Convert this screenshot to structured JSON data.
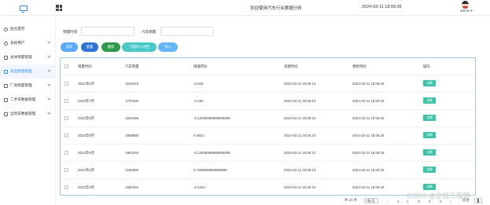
{
  "header": {
    "title": "欢迎使用汽车行业数据分析",
    "datetime": "2024-03-11 18:09:36",
    "username": "admin"
  },
  "sidebar": {
    "items": [
      {
        "label": "后台首页",
        "icon": "clock-icon",
        "has_children": false
      },
      {
        "label": "系统用户",
        "icon": "user-icon",
        "has_children": true
      },
      {
        "label": "总体销量管理",
        "icon": "doc-icon",
        "has_children": true
      },
      {
        "label": "车型销量管理",
        "icon": "doc-icon",
        "has_children": true
      },
      {
        "label": "厂商销量管理",
        "icon": "doc-icon",
        "has_children": true
      },
      {
        "label": "二手车数据管理",
        "icon": "doc-icon",
        "has_children": true
      },
      {
        "label": "全新车数据管理",
        "icon": "doc-icon",
        "has_children": true
      }
    ]
  },
  "filters": {
    "sales_time_label": "销量时间",
    "car_sales_label": "汽车销量",
    "sales_time_value": "",
    "car_sales_value": ""
  },
  "toolbar": {
    "search": "查询",
    "reset": "重置",
    "delete": "删除",
    "export": "下载导入文档",
    "import": "导入"
  },
  "colors": {
    "search": "#5aa8f8",
    "reset": "#2f73d8",
    "delete": "#2f9c4d",
    "export": "#47c9c9",
    "import": "#64b5f6",
    "detail": "#3fc3a8",
    "border": "#9ccce6"
  },
  "table": {
    "columns": [
      "销量时间",
      "汽车销量",
      "增速环比",
      "创建时间",
      "更新时间",
      "操作"
    ],
    "detail_label": "详情",
    "rows": [
      [
        "2021年5月",
        "1642019",
        "-0.019",
        "2024-03-11 18:05:10",
        "2024-03-11 18:09:18"
      ],
      [
        "2023年7月",
        "1701080",
        "-0.162",
        "2024-03-11 18:05:10",
        "2024-03-11 18:09:18"
      ],
      [
        "2023年9月",
        "1923455",
        "-0.12099999999999999",
        "2024-03-11 18:05:10",
        "2024-03-11 18:09:18"
      ],
      [
        "2023年8月",
        "1988980",
        "0.0651",
        "2024-03-11 18:05:10",
        "2024-03-11 18:09:18"
      ],
      [
        "2023年5月",
        "1894293",
        "-0.12939999999999999",
        "2024-03-11 18:05:10",
        "2024-03-11 18:09:18"
      ],
      [
        "2023年4月",
        "1630950",
        "0.7358999999999999",
        "2024-03-11 18:05:10",
        "2024-03-11 18:09:18"
      ],
      [
        "2023年3月",
        "1550454",
        "-0.1244",
        "2024-03-11 18:05:10",
        "2024-03-11 18:09:18"
      ]
    ]
  },
  "pagination": {
    "total": "共 23 条",
    "page_size": "7条/页",
    "pages": [
      "1",
      "2",
      "3",
      "4",
      "5"
    ],
    "current": "2",
    "goto_label": "前往",
    "goto_value": "1"
  },
  "watermark": "CSDN @全栈工程师"
}
